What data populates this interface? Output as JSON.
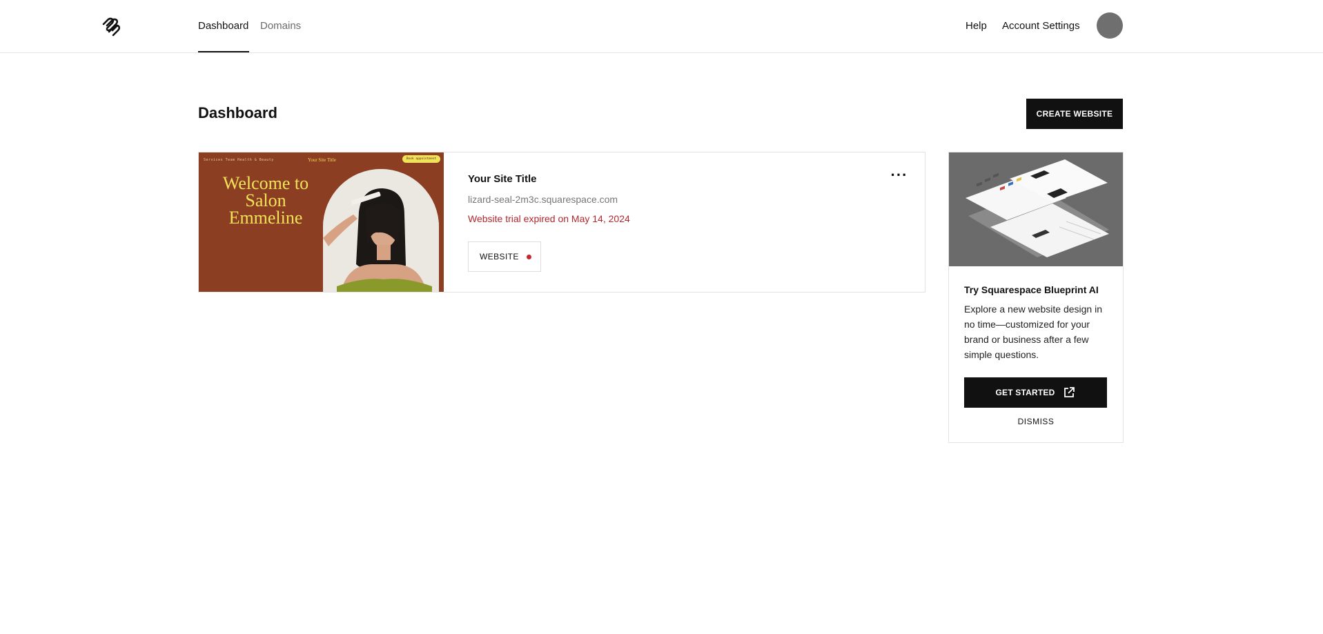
{
  "header": {
    "logo_icon": "squarespace-logo-icon",
    "tabs": [
      {
        "label": "Dashboard",
        "active": true
      },
      {
        "label": "Domains",
        "active": false
      }
    ],
    "help_label": "Help",
    "account_settings_label": "Account Settings",
    "avatar_icon": "user-avatar"
  },
  "main": {
    "title": "Dashboard",
    "create_button_label": "CREATE WEBSITE"
  },
  "site": {
    "thumbnail": {
      "nav_text": "Services   Team   Health & Beauty",
      "site_title": "Your Site Title",
      "book_button": "Book appointment",
      "hero_text": "Welcome to Salon Emmeline"
    },
    "name": "Your Site Title",
    "domain": "lizard-seal-2m3c.squarespace.com",
    "status": "Website trial expired on May 14, 2024",
    "status_color": "#b2272d",
    "badge_label": "WEBSITE",
    "badge_dot_color": "#c5282f",
    "more_icon": "more-horizontal-icon"
  },
  "promo": {
    "title": "Try Squarespace Blueprint AI",
    "body": "Explore a new website design in no time—customized for your brand or business after a few simple questions.",
    "cta_label": "GET STARTED",
    "cta_icon": "external-link-icon",
    "dismiss_label": "DISMISS"
  }
}
